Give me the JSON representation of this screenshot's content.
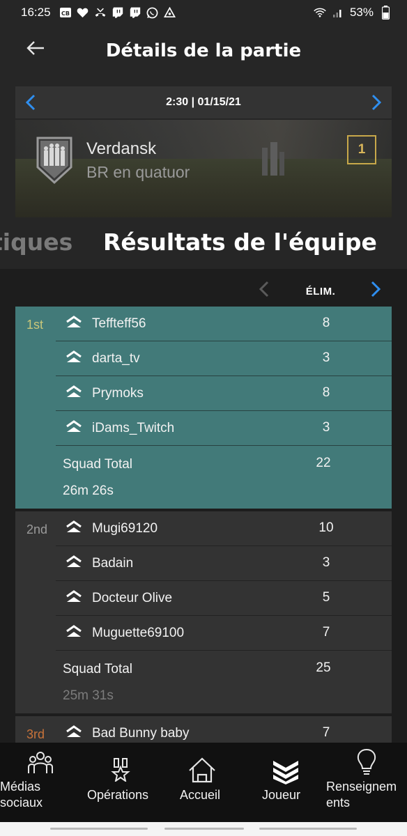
{
  "status_bar": {
    "time": "16:25",
    "battery": "53%"
  },
  "header": {
    "title": "Détails de la partie"
  },
  "date_nav": {
    "text": "2:30 | 01/15/21"
  },
  "map_card": {
    "map_name": "Verdansk",
    "mode": "BR en quatuor",
    "placement": "1"
  },
  "tabs": {
    "previous": "tiques",
    "active": "Résultats de l'équipe"
  },
  "stat_header": {
    "label": "ÉLIM."
  },
  "squads": [
    {
      "placement": "1st",
      "players": [
        {
          "name": "Teffteff56",
          "value": "8"
        },
        {
          "name": "darta_tv",
          "value": "3"
        },
        {
          "name": "Prymoks",
          "value": "8"
        },
        {
          "name": "iDams_Twitch",
          "value": "3"
        }
      ],
      "total_label": "Squad Total",
      "total": "22",
      "time": "26m 26s"
    },
    {
      "placement": "2nd",
      "players": [
        {
          "name": "Mugi69120",
          "value": "10"
        },
        {
          "name": "Badain",
          "value": "3"
        },
        {
          "name": "Docteur Olive",
          "value": "5"
        },
        {
          "name": "Muguette69100",
          "value": "7"
        }
      ],
      "total_label": "Squad Total",
      "total": "25",
      "time": "25m 31s"
    },
    {
      "placement": "3rd",
      "players": [
        {
          "name": "Bad Bunny baby",
          "value": "7"
        }
      ]
    }
  ],
  "bottom_nav": {
    "items": [
      {
        "label_line1": "Médias",
        "label_line2": "sociaux",
        "icon": "people-icon"
      },
      {
        "label_line1": "Opérations",
        "label_line2": "",
        "icon": "medal-icon"
      },
      {
        "label_line1": "Accueil",
        "label_line2": "",
        "icon": "home-icon"
      },
      {
        "label_line1": "Joueur",
        "label_line2": "",
        "icon": "chevrons-icon"
      },
      {
        "label_line1": "Renseignem",
        "label_line2": "ents",
        "icon": "lightbulb-icon"
      }
    ]
  },
  "colors": {
    "background": "#262626",
    "results_bg": "#1d1d1d",
    "winner_row": "#427a79",
    "other_row": "#333333",
    "accent_blue": "#2f8ff0",
    "gold": "#c8a84a",
    "first_place": "#c9c77a",
    "third_place": "#c8733a"
  }
}
